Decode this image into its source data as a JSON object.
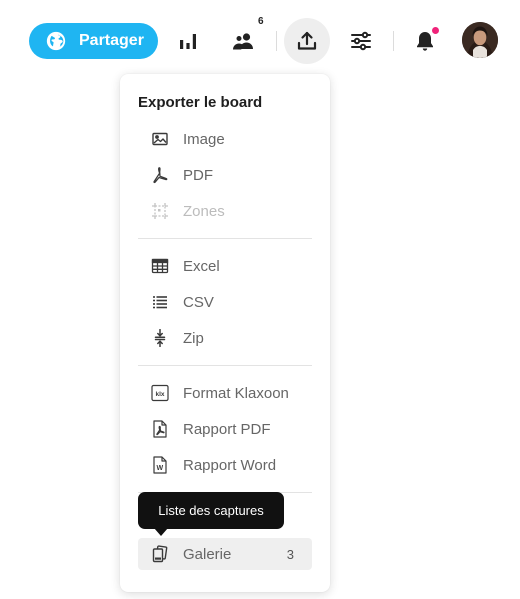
{
  "toolbar": {
    "share_label": "Partager",
    "members_count": "6",
    "icons": {
      "share": "globe-icon",
      "stats": "bar-chart-icon",
      "members": "users-icon",
      "export": "upload-icon",
      "settings": "sliders-icon",
      "notifications": "bell-icon",
      "avatar": "user-avatar"
    },
    "colors": {
      "share_bg": "#1fb5f2",
      "notification_dot": "#f0237a",
      "active_icon_bg": "#eeeeee"
    }
  },
  "export_menu": {
    "title": "Exporter le board",
    "groups": [
      [
        {
          "label": "Image",
          "icon": "image-icon",
          "enabled": true
        },
        {
          "label": "PDF",
          "icon": "pdf-icon",
          "enabled": true
        },
        {
          "label": "Zones",
          "icon": "zones-icon",
          "enabled": false
        }
      ],
      [
        {
          "label": "Excel",
          "icon": "table-icon",
          "enabled": true
        },
        {
          "label": "CSV",
          "icon": "list-icon",
          "enabled": true
        },
        {
          "label": "Zip",
          "icon": "zip-icon",
          "enabled": true
        }
      ],
      [
        {
          "label": "Format Klaxoon",
          "icon": "klx-icon",
          "enabled": true
        },
        {
          "label": "Rapport PDF",
          "icon": "pdf-file-icon",
          "enabled": true
        },
        {
          "label": "Rapport Word",
          "icon": "word-file-icon",
          "enabled": true
        }
      ]
    ],
    "gallery": {
      "label": "Galerie",
      "count": "3",
      "icon": "gallery-icon"
    }
  },
  "tooltip": {
    "text": "Liste des captures"
  }
}
